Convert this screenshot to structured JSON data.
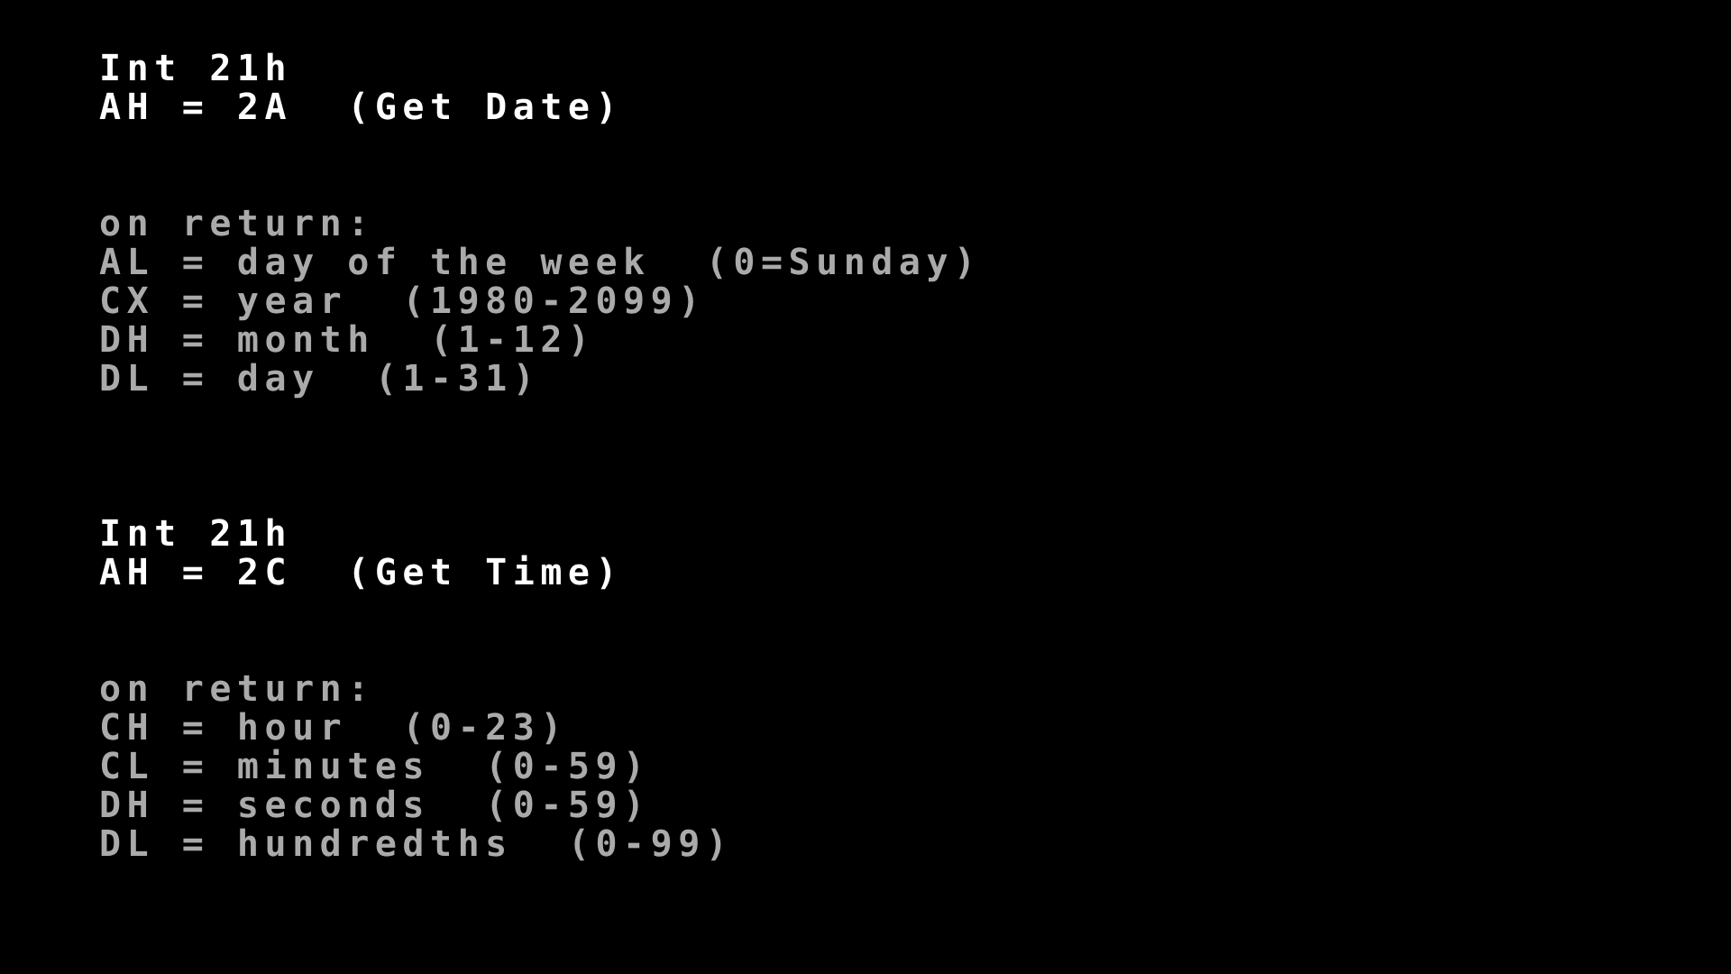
{
  "screen": {
    "background_color": "#000000",
    "heading_color": "#ffffff",
    "body_color": "#aaaaaa",
    "mode": "text-mode-reference"
  },
  "sections": [
    {
      "id": "get-date",
      "title_lines": [
        {
          "text": "Int 21h",
          "style": "heading"
        },
        {
          "text": "AH = 2A  (Get Date)",
          "style": "heading"
        }
      ],
      "return_label": {
        "text": "on return:",
        "style": "body"
      },
      "registers": [
        {
          "text": "AL = day of the week  (0=Sunday)",
          "style": "body"
        },
        {
          "text": "CX = year  (1980-2099)",
          "style": "body"
        },
        {
          "text": "DH = month  (1-12)",
          "style": "body"
        },
        {
          "text": "DL = day  (1-31)",
          "style": "body"
        }
      ]
    },
    {
      "id": "get-time",
      "title_lines": [
        {
          "text": "Int 21h",
          "style": "heading"
        },
        {
          "text": "AH = 2C  (Get Time)",
          "style": "heading"
        }
      ],
      "return_label": {
        "text": "on return:",
        "style": "body"
      },
      "registers": [
        {
          "text": "CH = hour  (0-23)",
          "style": "body"
        },
        {
          "text": "CL = minutes  (0-59)",
          "style": "body"
        },
        {
          "text": "DH = seconds  (0-59)",
          "style": "body"
        },
        {
          "text": "DL = hundredths  (0-99)",
          "style": "body"
        }
      ]
    }
  ],
  "lines": [
    {
      "text": "Int 21h",
      "style": "heading"
    },
    {
      "text": "AH = 2A  (Get Date)",
      "style": "heading"
    },
    {
      "text": "",
      "style": "blank"
    },
    {
      "text": "",
      "style": "blank"
    },
    {
      "text": "on return:",
      "style": "body"
    },
    {
      "text": "AL = day of the week  (0=Sunday)",
      "style": "body"
    },
    {
      "text": "CX = year  (1980-2099)",
      "style": "body"
    },
    {
      "text": "DH = month  (1-12)",
      "style": "body"
    },
    {
      "text": "DL = day  (1-31)",
      "style": "body"
    },
    {
      "text": "",
      "style": "blank"
    },
    {
      "text": "",
      "style": "blank"
    },
    {
      "text": "",
      "style": "blank"
    },
    {
      "text": "Int 21h",
      "style": "heading"
    },
    {
      "text": "AH = 2C  (Get Time)",
      "style": "heading"
    },
    {
      "text": "",
      "style": "blank"
    },
    {
      "text": "",
      "style": "blank"
    },
    {
      "text": "on return:",
      "style": "body"
    },
    {
      "text": "CH = hour  (0-23)",
      "style": "body"
    },
    {
      "text": "CL = minutes  (0-59)",
      "style": "body"
    },
    {
      "text": "DH = seconds  (0-59)",
      "style": "body"
    },
    {
      "text": "DL = hundredths  (0-99)",
      "style": "body"
    }
  ]
}
